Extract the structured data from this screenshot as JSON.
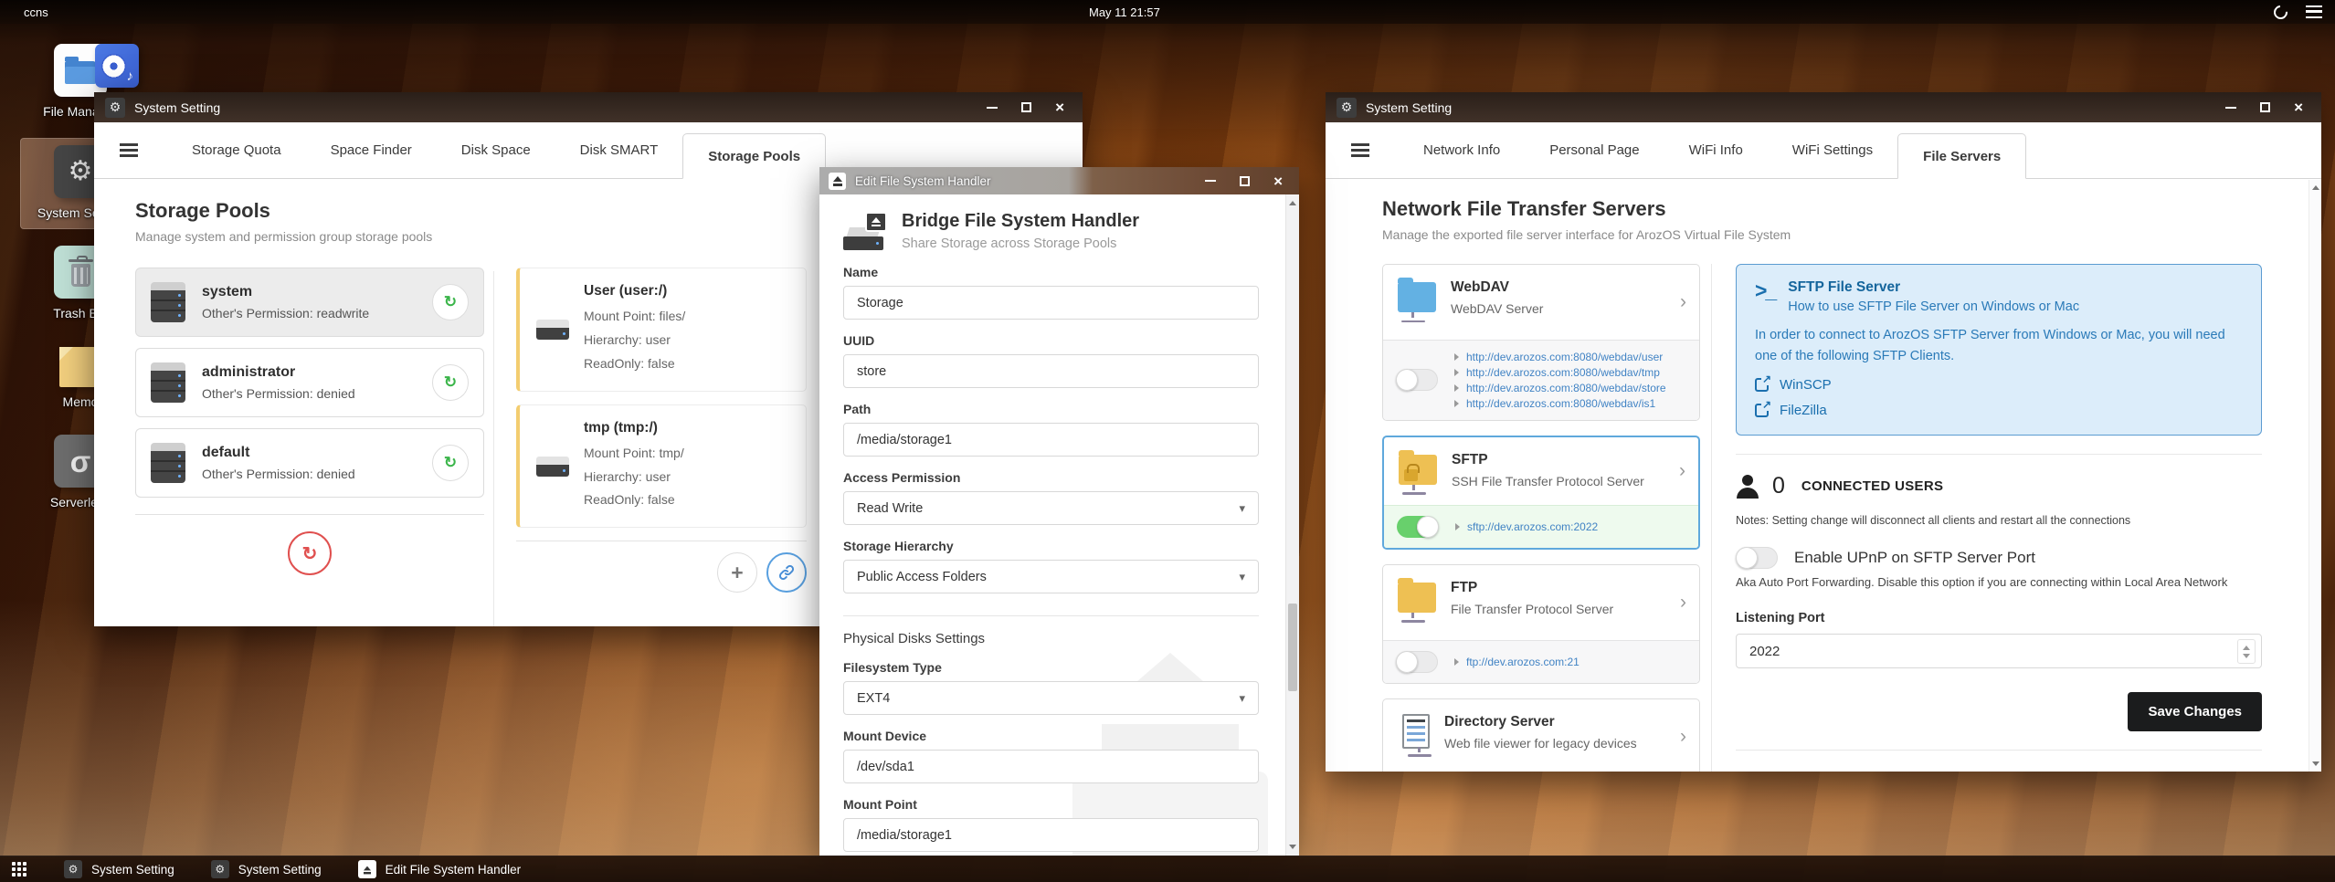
{
  "topbar": {
    "hostname": "ccns",
    "clock": "May 11 21:57"
  },
  "desktop": {
    "icons": [
      {
        "label": "File Manager"
      },
      {
        "label": "System Setting"
      },
      {
        "label": "Trash Bin"
      },
      {
        "label": "Memo"
      },
      {
        "label": "Serverless"
      }
    ]
  },
  "window_storage": {
    "title": "System Setting",
    "tabs": [
      {
        "label": "Storage Quota"
      },
      {
        "label": "Space Finder"
      },
      {
        "label": "Disk Space"
      },
      {
        "label": "Disk SMART"
      },
      {
        "label": "Storage Pools"
      }
    ],
    "heading": "Storage Pools",
    "subheading": "Manage system and permission group storage pools",
    "pools": [
      {
        "name": "system",
        "permission": "Other's Permission: readwrite"
      },
      {
        "name": "administrator",
        "permission": "Other's Permission: denied"
      },
      {
        "name": "default",
        "permission": "Other's Permission: denied"
      }
    ],
    "mounts": [
      {
        "title": "User (user:/)",
        "mount_point": "Mount Point: files/",
        "hierarchy": "Hierarchy: user",
        "readonly": "ReadOnly: false"
      },
      {
        "title": "tmp (tmp:/)",
        "mount_point": "Mount Point: tmp/",
        "hierarchy": "Hierarchy: user",
        "readonly": "ReadOnly: false"
      }
    ]
  },
  "window_edit": {
    "title": "Edit File System Handler",
    "header": {
      "title": "Bridge File System Handler",
      "subtitle": "Share Storage across Storage Pools"
    },
    "fields": {
      "name_label": "Name",
      "name_value": "Storage",
      "uuid_label": "UUID",
      "uuid_value": "store",
      "path_label": "Path",
      "path_value": "/media/storage1",
      "access_label": "Access Permission",
      "access_value": "Read Write",
      "hierarchy_label": "Storage Hierarchy",
      "hierarchy_value": "Public Access Folders",
      "section_title": "Physical Disks Settings",
      "fstype_label": "Filesystem Type",
      "fstype_value": "EXT4",
      "mount_device_label": "Mount Device",
      "mount_device_value": "/dev/sda1",
      "mount_point_label": "Mount Point",
      "mount_point_value": "/media/storage1"
    }
  },
  "window_network": {
    "title": "System Setting",
    "tabs": [
      {
        "label": "Network Info"
      },
      {
        "label": "Personal Page"
      },
      {
        "label": "WiFi Info"
      },
      {
        "label": "WiFi Settings"
      },
      {
        "label": "File Servers"
      }
    ],
    "heading": "Network File Transfer Servers",
    "subheading": "Manage the exported file server interface for ArozOS Virtual File System",
    "servers": [
      {
        "name": "WebDAV",
        "desc": "WebDAV Server",
        "enabled": false,
        "urls": [
          "http://dev.arozos.com:8080/webdav/user",
          "http://dev.arozos.com:8080/webdav/tmp",
          "http://dev.arozos.com:8080/webdav/store",
          "http://dev.arozos.com:8080/webdav/is1"
        ]
      },
      {
        "name": "SFTP",
        "desc": "SSH File Transfer Protocol Server",
        "enabled": true,
        "url": "sftp://dev.arozos.com:2022"
      },
      {
        "name": "FTP",
        "desc": "File Transfer Protocol Server",
        "enabled": false,
        "url": "ftp://dev.arozos.com:21"
      },
      {
        "name": "Directory Server",
        "desc": "Web file viewer for legacy devices"
      }
    ],
    "sftp_panel": {
      "info_title": "SFTP File Server",
      "info_subtitle": "How to use SFTP File Server on Windows or Mac",
      "info_body": "In order to connect to ArozOS SFTP Server from Windows or Mac, you will need one of the following SFTP Clients.",
      "clients": [
        {
          "label": "WinSCP"
        },
        {
          "label": "FileZilla"
        }
      ],
      "connected_count": "0",
      "connected_label": "CONNECTED USERS",
      "notes": "Notes: Setting change will disconnect all clients and restart all the connections",
      "upnp_label": "Enable UPnP on SFTP Server Port",
      "upnp_note": "Aka Auto Port Forwarding. Disable this option if you are connecting within Local Area Network",
      "port_label": "Listening Port",
      "port_value": "2022",
      "save_label": "Save Changes"
    }
  },
  "taskbar": {
    "items": [
      {
        "label": "System Setting"
      },
      {
        "label": "System Setting"
      },
      {
        "label": "Edit File System Handler"
      }
    ]
  },
  "colors": {
    "link_blue": "#4183c4",
    "toggle_on_green": "#68d06c",
    "selected_card_blue": "#5fa8dc",
    "mount_card_yellow": "#f3cd70",
    "save_button_black": "#1b1c1d",
    "refresh_green": "#3bb54a",
    "refresh_red": "#e0504f"
  }
}
